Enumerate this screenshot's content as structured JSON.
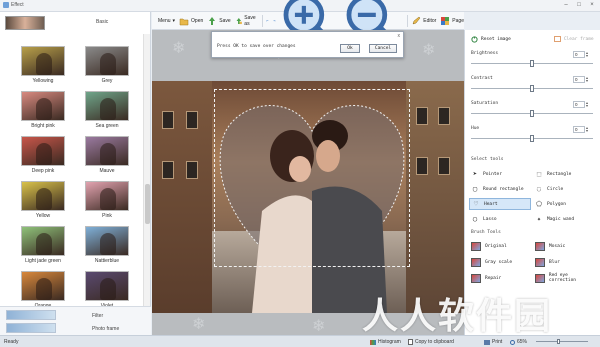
{
  "app": {
    "title": "Effect"
  },
  "left_panel": {
    "category_label": "Basic",
    "filters": [
      {
        "label": "Yellowing",
        "tint": "#b8a04a"
      },
      {
        "label": "Grey",
        "tint": "#8a8a8a"
      },
      {
        "label": "Bright pink",
        "tint": "#d88a80"
      },
      {
        "label": "Sea green",
        "tint": "#6fa58a"
      },
      {
        "label": "Deep pink",
        "tint": "#c8564a"
      },
      {
        "label": "Mauve",
        "tint": "#9a7aa0"
      },
      {
        "label": "Yellow",
        "tint": "#d9c24a"
      },
      {
        "label": "Pink",
        "tint": "#e2a3b0"
      },
      {
        "label": "Light jade green",
        "tint": "#8fc27a"
      },
      {
        "label": "Nattierblue",
        "tint": "#7fb0d8"
      },
      {
        "label": "Orange",
        "tint": "#d8883c"
      },
      {
        "label": "Violet",
        "tint": "#5a4a70"
      }
    ],
    "bottom_tabs": [
      "Filter",
      "Photo frame"
    ]
  },
  "toolbar": {
    "menu": "Menu",
    "open": "Open",
    "save": "Save",
    "save_as": "Save as",
    "editor": "Editor",
    "page": "Page"
  },
  "dialog": {
    "message": "Press OK to save over changes",
    "ok": "Ok",
    "cancel": "Cancel",
    "close": "x"
  },
  "right_panel": {
    "reset": "Reset image",
    "clear": "Clear frame",
    "adjustments": [
      {
        "label": "Brightness",
        "value": "0",
        "level": 0.5
      },
      {
        "label": "Contrast",
        "value": "0",
        "level": 0.5
      },
      {
        "label": "Saturation",
        "value": "0",
        "level": 0.5
      },
      {
        "label": "Hue",
        "value": "0",
        "level": 0.5
      }
    ],
    "select_tools_title": "Select tools",
    "select_tools": [
      {
        "label": "Pointer",
        "icon": "pointer-icon",
        "glyph": "➤"
      },
      {
        "label": "Rectangle",
        "icon": "rectangle-icon",
        "glyph": "⬚"
      },
      {
        "label": "Round rectangle",
        "icon": "round-rectangle-icon",
        "glyph": "▢"
      },
      {
        "label": "Circle",
        "icon": "circle-icon",
        "glyph": "◌"
      },
      {
        "label": "Heart",
        "icon": "heart-icon",
        "glyph": "♡"
      },
      {
        "label": "Polygon",
        "icon": "polygon-icon",
        "glyph": "⬠"
      },
      {
        "label": "Lasso",
        "icon": "lasso-icon",
        "glyph": "◯"
      },
      {
        "label": "Magic wand",
        "icon": "magic-wand-icon",
        "glyph": "✦"
      }
    ],
    "brush_tools_title": "Brush Tools",
    "brush_tools": [
      {
        "label": "Original"
      },
      {
        "label": "Mosaic"
      },
      {
        "label": "Gray scale"
      },
      {
        "label": "Blur"
      },
      {
        "label": "Repair"
      },
      {
        "label": "Red eye correction"
      }
    ]
  },
  "status": {
    "ready": "Ready",
    "histogram": "Histogram",
    "copy": "Copy to clipboard",
    "print": "Print",
    "zoom": "65%",
    "zoom_level": 0.4
  },
  "watermark": "人人软件园"
}
